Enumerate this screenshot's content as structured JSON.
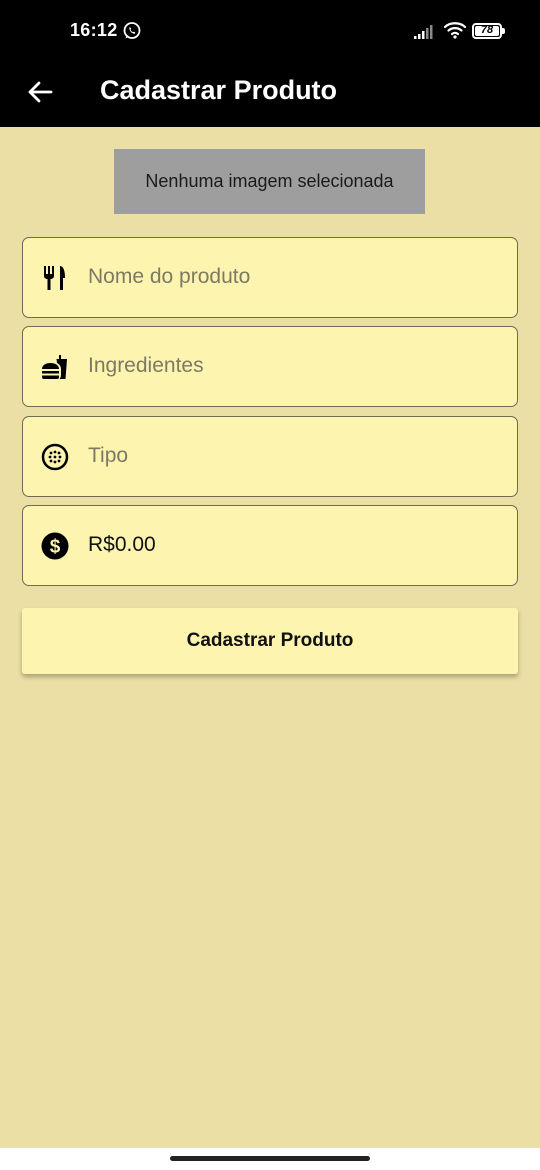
{
  "status_bar": {
    "time": "16:12",
    "battery": "78",
    "icons": [
      "whatsapp-icon",
      "signal-icon",
      "wifi-icon",
      "battery-icon"
    ]
  },
  "app_bar": {
    "title": "Cadastrar Produto",
    "back_icon": "arrow-back-icon"
  },
  "image_picker": {
    "label": "Nenhuma imagem selecionada"
  },
  "form": {
    "name": {
      "placeholder": "Nome do produto",
      "value": "",
      "icon": "restaurant-icon"
    },
    "ingredients": {
      "placeholder": "Ingredientes",
      "value": "",
      "icon": "fastfood-icon"
    },
    "type": {
      "placeholder": "Tipo",
      "value": "",
      "icon": "pizza-icon"
    },
    "price": {
      "placeholder": "",
      "value": "R$0.00",
      "icon": "dollar-icon"
    }
  },
  "submit": {
    "label": "Cadastrar Produto"
  },
  "colors": {
    "background": "#ebdfa5",
    "field_background": "#fdf4b0",
    "app_bar": "#000000",
    "image_box": "#9e9e9e"
  }
}
